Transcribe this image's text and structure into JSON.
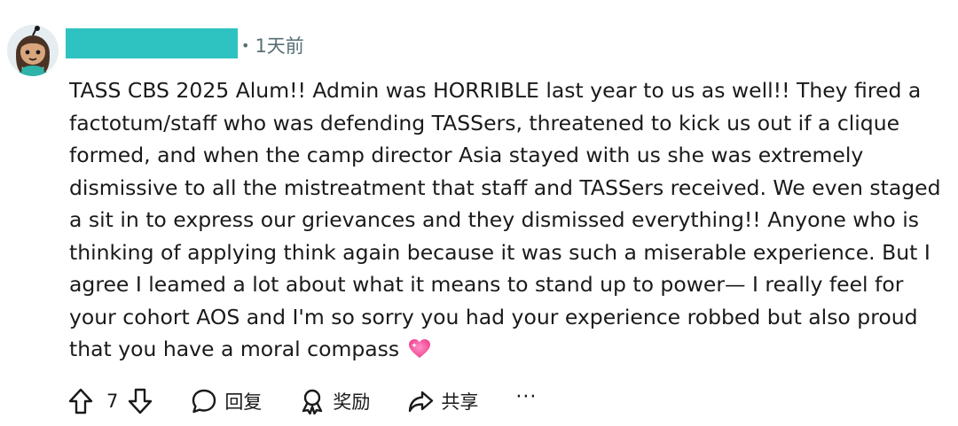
{
  "comment": {
    "time": "1天前",
    "meta_separator": "•",
    "body": "TASS CBS 2025 Alum!! Admin was HORRIBLE last year to us as well!! They fired a factotum/staff who was defending TASSers, threatened to kick us out if a clique formed, and when the camp director Asia stayed with us she was extremely dismissive to all the mistreatment that staff and TASSers received. We even staged a sit in to express our grievances and they dismissed everything!! Anyone who is thinking of applying think again because it was such a miserable experience. But I agree I leamed a lot about what it means to stand up to power— I really feel for your cohort AOS and I'm so sorry you had your experience robbed but also proud that you have a moral compass",
    "emoji": "sparkling-heart-icon",
    "username_redaction_color": "#2ec3c0"
  },
  "actions": {
    "vote_count": "7",
    "reply_label": "回复",
    "award_label": "奖励",
    "share_label": "共享",
    "more_label": "···"
  }
}
